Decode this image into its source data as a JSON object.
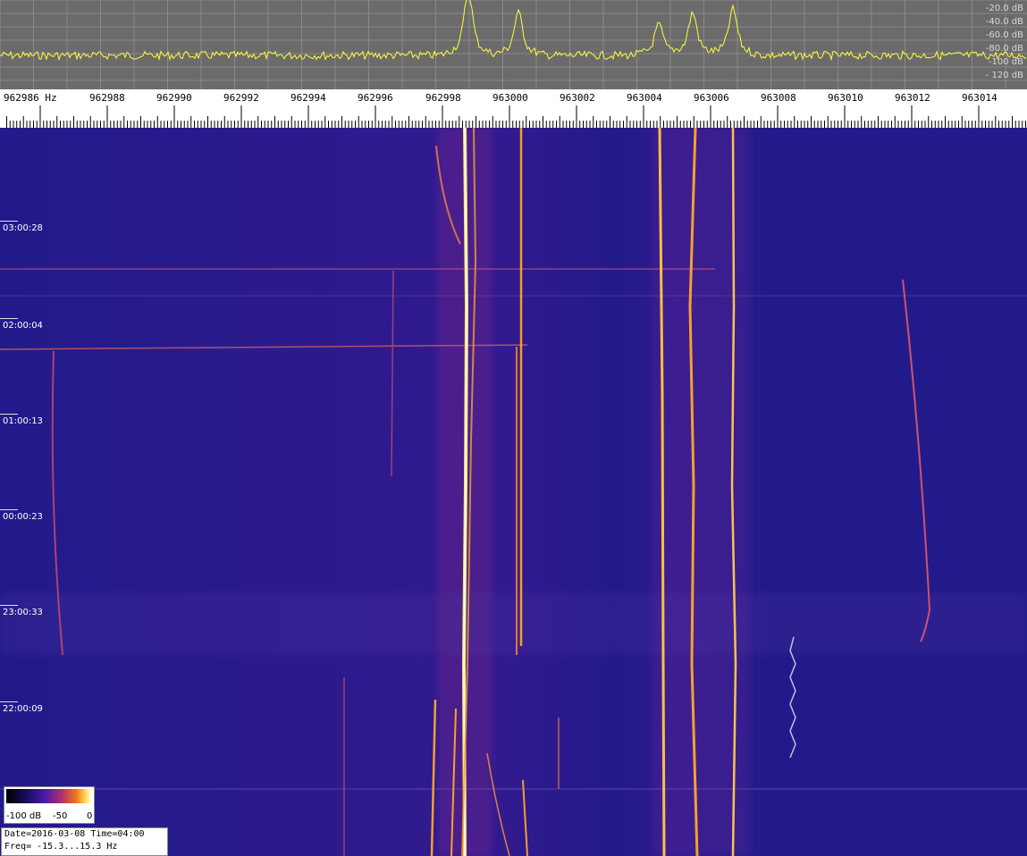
{
  "spectrum": {
    "db_labels": [
      "-20.0 dB",
      "-40.0 dB",
      "-60.0 dB",
      "-80.0 dB",
      "-100 dB",
      "- 120 dB"
    ],
    "trace_color": "#ffff3a",
    "background_color": "#6b6b6b",
    "grid_color": "#8a8a8a"
  },
  "freq_axis": {
    "labels": [
      "962986 Hz",
      "962988",
      "962990",
      "962992",
      "962994",
      "962996",
      "962998",
      "963000",
      "963002",
      "963004",
      "963006",
      "963008",
      "963010",
      "963012",
      "963014"
    ]
  },
  "waterfall": {
    "background_color": "#221a8a",
    "time_labels": [
      "03:00:28",
      "02:00:04",
      "01:00:13",
      "00:00:23",
      "23:00:33",
      "22:00:09"
    ]
  },
  "legend": {
    "min_label": "-100 dB",
    "mid_label": "-50",
    "max_label": "0"
  },
  "info": {
    "date_line": "Date=2016-03-08 Time=04:00",
    "freq_line": "Freq= -15.3...15.3 Hz"
  }
}
